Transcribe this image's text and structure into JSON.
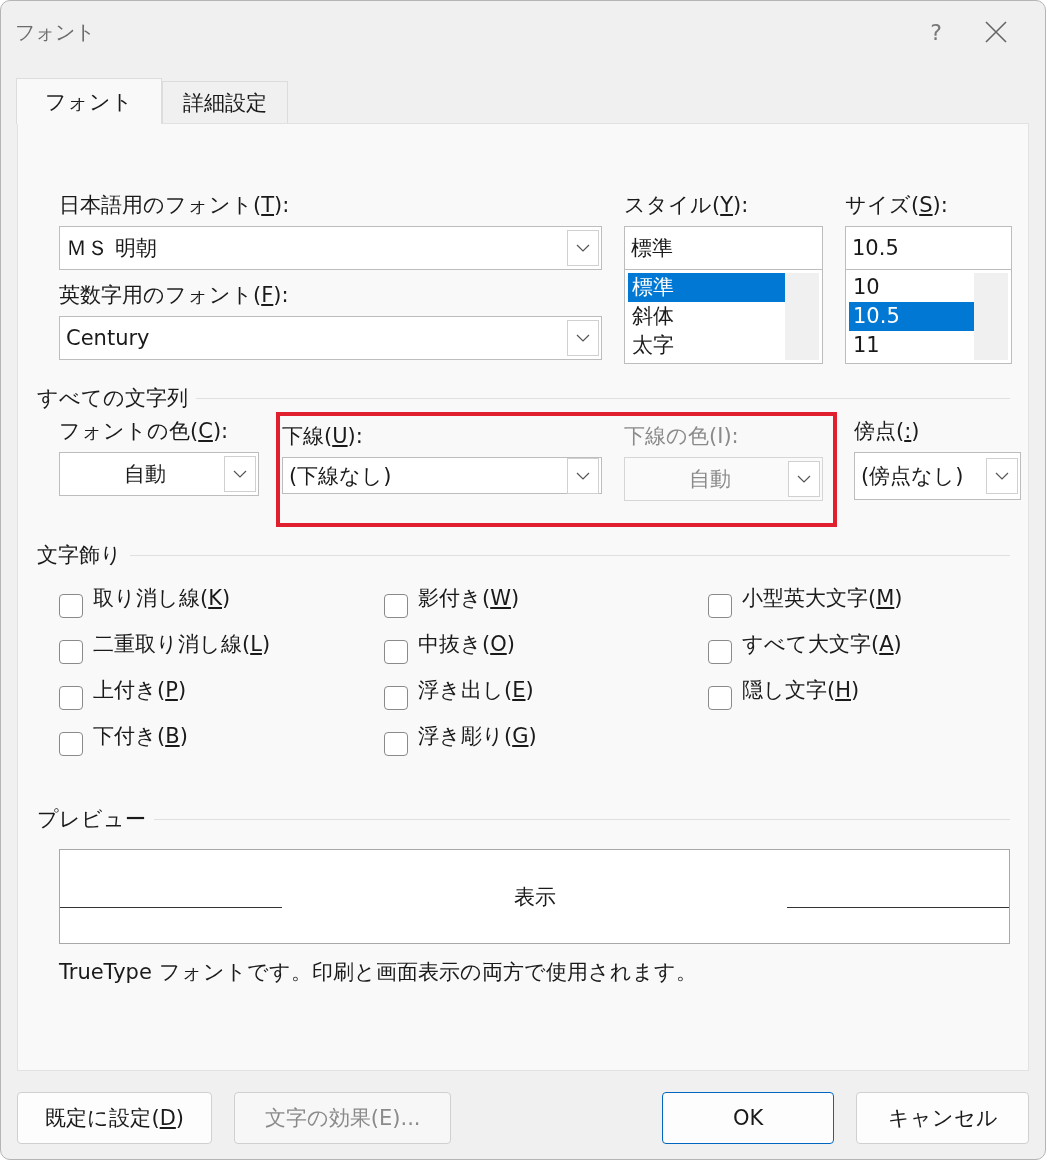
{
  "window": {
    "title": "フォント",
    "help": "?"
  },
  "tabs": [
    {
      "label": "フォント",
      "selected": true
    },
    {
      "label": "詳細設定",
      "selected": false
    }
  ],
  "font_section": {
    "japanese_font": {
      "label": {
        "text": "日本語用のフォント(",
        "key": "T",
        "tail": "):"
      },
      "value": "ＭＳ 明朝"
    },
    "western_font": {
      "label": {
        "text": "英数字用のフォント(",
        "key": "F",
        "tail": "):"
      },
      "value": "Century"
    },
    "style": {
      "label": {
        "text": "スタイル(",
        "key": "Y",
        "tail": "):"
      },
      "value": "標準",
      "options": [
        {
          "text": "標準",
          "selected": true
        },
        {
          "text": "斜体",
          "selected": false
        },
        {
          "text": "太字",
          "selected": false
        }
      ]
    },
    "size": {
      "label": {
        "text": "サイズ(",
        "key": "S",
        "tail": "):"
      },
      "value": "10.5",
      "options": [
        {
          "text": "10",
          "selected": false
        },
        {
          "text": "10.5",
          "selected": true
        },
        {
          "text": "11",
          "selected": false
        }
      ]
    }
  },
  "all_text": {
    "title": "すべての文字列",
    "font_color": {
      "kind": "color",
      "label": {
        "text": "フォントの色(",
        "key": "C",
        "tail": "):"
      },
      "value": "自動",
      "disabled": false
    },
    "underline_group": {
      "highlighted": true,
      "underline": {
        "kind": "list",
        "label": {
          "text": "下線(",
          "key": "U",
          "tail": "):"
        },
        "value": "(下線なし)",
        "disabled": false
      },
      "underline_color": {
        "kind": "color",
        "label": {
          "text": "下線の色(I):"
        },
        "value": "自動",
        "disabled": true
      }
    },
    "emphasis": {
      "kind": "list",
      "label": {
        "text": "傍点(",
        "key": ":",
        "tail": ")"
      },
      "value": "(傍点なし)",
      "disabled": false
    }
  },
  "effects": {
    "title": "文字飾り",
    "items": [
      {
        "label": {
          "text": "取り消し線(",
          "key": "K",
          "tail": ")"
        },
        "checked": false
      },
      {
        "label": {
          "text": "二重取り消し線(",
          "key": "L",
          "tail": ")"
        },
        "checked": false
      },
      {
        "label": {
          "text": "上付き(",
          "key": "P",
          "tail": ")"
        },
        "checked": false
      },
      {
        "label": {
          "text": "下付き(",
          "key": "B",
          "tail": ")"
        },
        "checked": false
      },
      {
        "label": {
          "text": "影付き(",
          "key": "W",
          "tail": ")"
        },
        "checked": false
      },
      {
        "label": {
          "text": "中抜き(",
          "key": "O",
          "tail": ")"
        },
        "checked": false
      },
      {
        "label": {
          "text": "浮き出し(",
          "key": "E",
          "tail": ")"
        },
        "checked": false
      },
      {
        "label": {
          "text": "浮き彫り(",
          "key": "G",
          "tail": ")"
        },
        "checked": false
      },
      {
        "label": {
          "text": "小型英大文字(",
          "key": "M",
          "tail": ")"
        },
        "checked": false
      },
      {
        "label": {
          "text": "すべて大文字(",
          "key": "A",
          "tail": ")"
        },
        "checked": false
      },
      {
        "label": {
          "text": "隠し文字(",
          "key": "H",
          "tail": ")"
        },
        "checked": false
      }
    ]
  },
  "preview": {
    "title": "プレビュー",
    "sample": "表示",
    "description": "TrueType フォントです。印刷と画面表示の両方で使用されます。"
  },
  "buttons": [
    {
      "label": {
        "text": "既定に設定(",
        "key": "D",
        "tail": ")"
      },
      "disabled": false,
      "default": false
    },
    {
      "label": {
        "text": "文字の効果(E)..."
      },
      "disabled": true,
      "default": false
    },
    {
      "label": {
        "text": "OK"
      },
      "disabled": false,
      "default": true
    },
    {
      "label": {
        "text": "キャンセル"
      },
      "disabled": false,
      "default": false
    }
  ]
}
